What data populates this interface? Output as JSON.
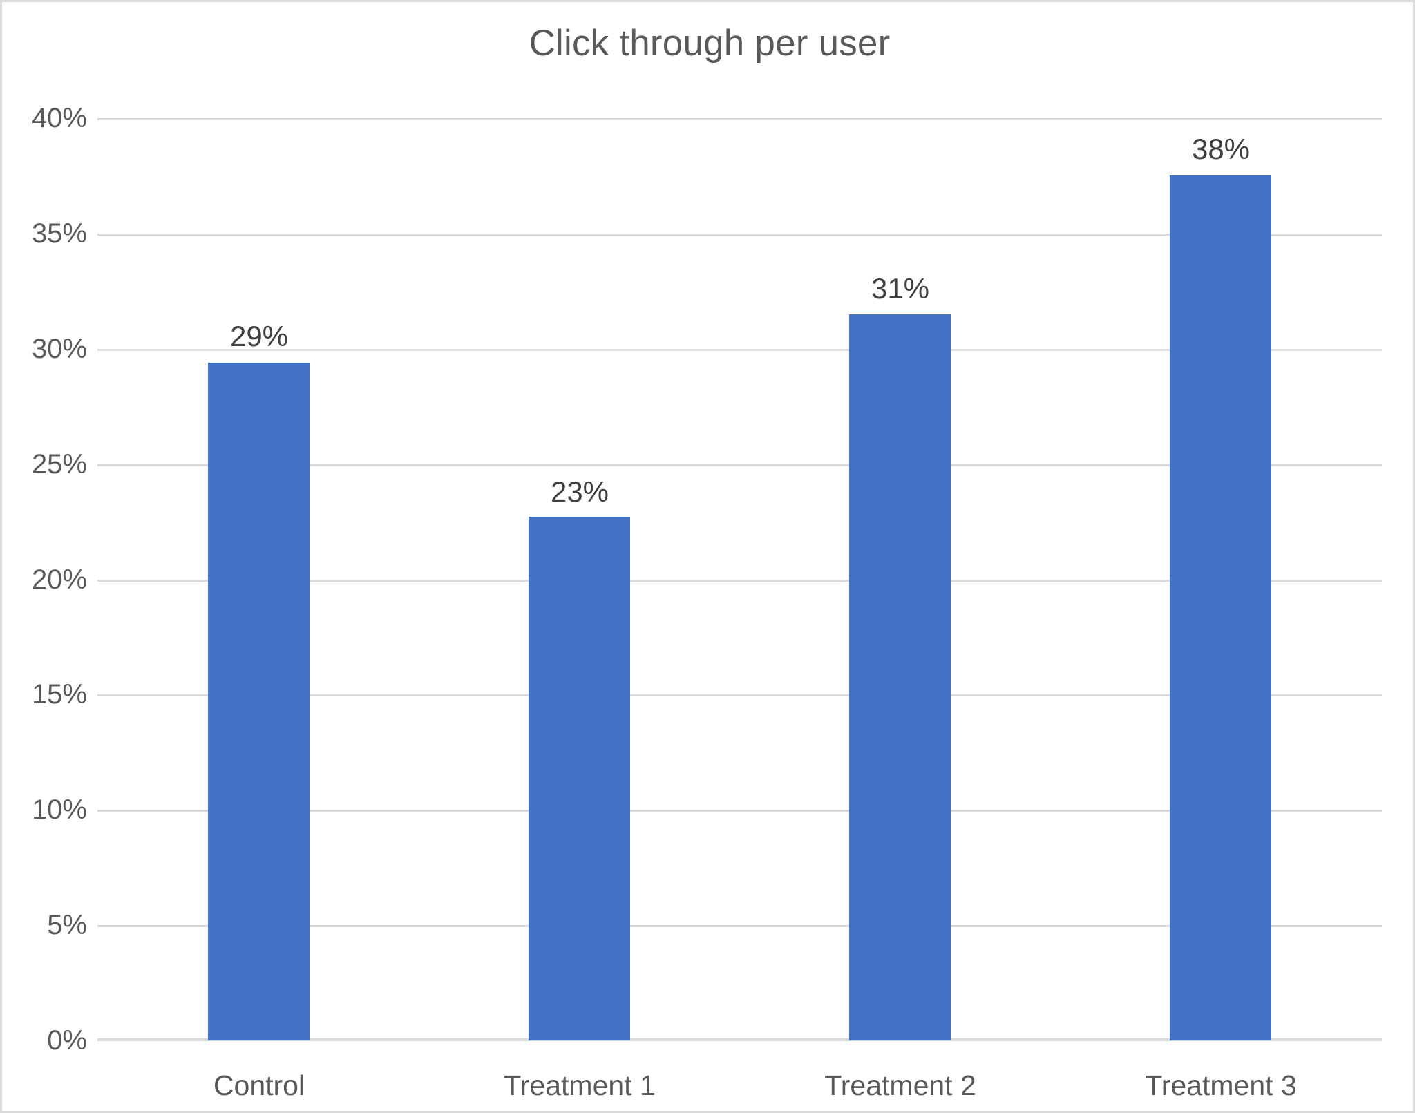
{
  "chart_data": {
    "type": "bar",
    "title": "Click through per user",
    "xlabel": "",
    "ylabel": "",
    "categories": [
      "Control",
      "Treatment 1",
      "Treatment 2",
      "Treatment 3"
    ],
    "values": [
      29.4,
      22.7,
      31.5,
      37.5
    ],
    "data_labels": [
      "29%",
      "23%",
      "31%",
      "38%"
    ],
    "ylim": [
      0,
      40
    ],
    "ytick_values": [
      0,
      5,
      10,
      15,
      20,
      25,
      30,
      35,
      40
    ],
    "ytick_labels": [
      "0%",
      "5%",
      "10%",
      "15%",
      "20%",
      "25%",
      "30%",
      "35%",
      "40%"
    ],
    "grid": true,
    "legend": "none",
    "series": [
      {
        "name": "Click through per user",
        "values": [
          29.4,
          22.7,
          31.5,
          37.5
        ],
        "color": "#4472C4"
      }
    ],
    "colors": {
      "bar": "#4472C4",
      "gridline": "#D9D9D9",
      "title_text": "#595959",
      "tick_text": "#595959",
      "data_label_text": "#404040",
      "background": "#FFFFFF",
      "border": "#D9D9D9"
    }
  }
}
